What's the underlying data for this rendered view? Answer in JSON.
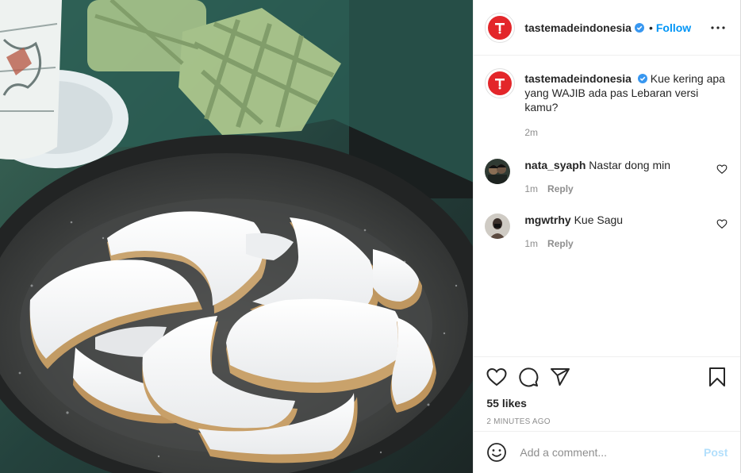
{
  "post": {
    "author": "tastemadeindonesia",
    "follow_label": "Follow",
    "dot": "•",
    "image_alt": "Kue putri salju"
  },
  "caption": {
    "username": "tastemadeindonesia",
    "text": "Kue kering apa yang WAJIB ada pas Lebaran versi kamu?",
    "time": "2m"
  },
  "comments": [
    {
      "username": "nata_syaph",
      "text": "Nastar dong min",
      "time": "1m",
      "reply_label": "Reply"
    },
    {
      "username": "mgwtrhy",
      "text": "Kue Sagu",
      "time": "1m",
      "reply_label": "Reply"
    }
  ],
  "footer": {
    "likes": "55 likes",
    "time_ago": "2 minutes ago"
  },
  "comment_box": {
    "placeholder": "Add a comment...",
    "post_label": "Post"
  },
  "icons": {
    "like": "heart-icon",
    "comment": "comment-icon",
    "share": "share-icon",
    "save": "bookmark-icon",
    "more": "more-options-icon",
    "emoji": "emoji-icon",
    "verified": "verified-badge-icon"
  },
  "colors": {
    "follow": "#0095f6",
    "post_button": "#b2dffc",
    "brand_red": "#e3262a",
    "verified": "#3897f0"
  }
}
